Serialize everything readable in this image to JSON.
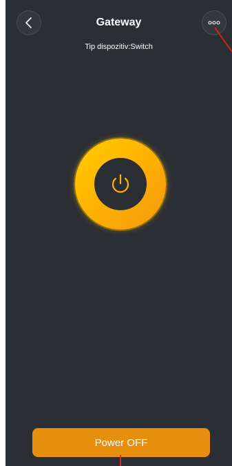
{
  "header": {
    "title": "Gateway",
    "subtitle": "Tip dispozitiv:Switch"
  },
  "icons": {
    "back": "chevron-left-icon",
    "more": "more-dots-icon",
    "power": "power-icon"
  },
  "main": {
    "power_state": "on"
  },
  "footer": {
    "power_button_label": "Power OFF"
  },
  "colors": {
    "background": "#2b2e33",
    "accent": "#ffb300",
    "button": "#e88e0f",
    "annotation": "#e2231a"
  }
}
